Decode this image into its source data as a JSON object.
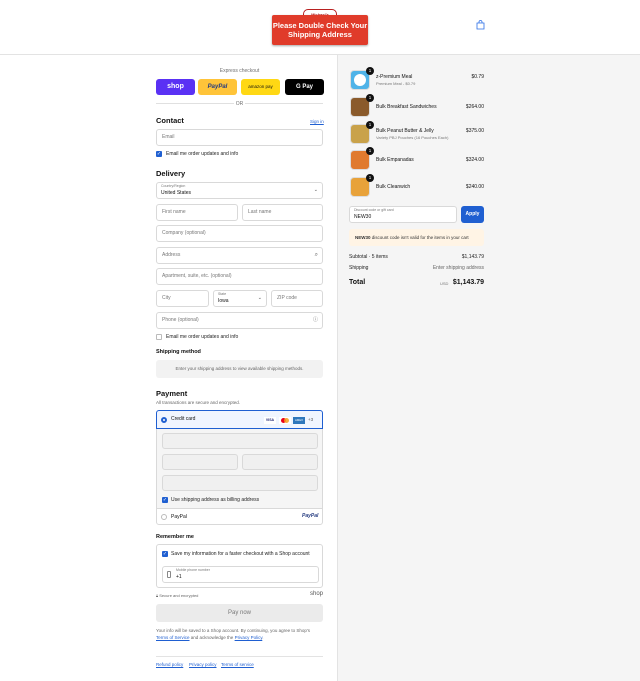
{
  "header": {
    "logo_badge": "Michael's KITCHEN",
    "logo_banner": "Please Double Check Your Shipping Address",
    "cart_icon": "bag-icon"
  },
  "express": {
    "label": "Express checkout",
    "shop": "shop",
    "paypal": "PayPal",
    "amazon": "amazon pay",
    "gpay": "G Pay",
    "or": "OR"
  },
  "contact": {
    "heading": "Contact",
    "signin": "Sign in",
    "email_placeholder": "Email",
    "email_opt": "Email me order updates and info"
  },
  "delivery": {
    "heading": "Delivery",
    "country_label": "Country/Region",
    "country_value": "United States",
    "first": "First name",
    "last": "Last name",
    "company": "Company (optional)",
    "address": "Address",
    "apartment": "Apartment, suite, etc. (optional)",
    "city": "City",
    "state_label": "State",
    "state_value": "Iowa",
    "zip": "ZIP code",
    "phone": "Phone (optional)",
    "phone_opt": "Email me order updates and info"
  },
  "shipping": {
    "heading": "Shipping method",
    "message": "Enter your shipping address to view available shipping methods."
  },
  "payment": {
    "heading": "Payment",
    "secure": "All transactions are secure and encrypted.",
    "credit": "Credit card",
    "cards": [
      "VISA",
      "MC",
      "AMEX",
      "+3"
    ],
    "billing": "Use shipping address as billing address",
    "paypal": "PayPal",
    "paypal_logo": "PayPal"
  },
  "remember": {
    "heading": "Remember me",
    "save": "Save my information for a faster checkout with a Shop account",
    "phone_label": "Mobile phone number",
    "phone_value": "+1",
    "secure": "Secure and encrypted",
    "shop": "shop",
    "pay": "Pay now",
    "legal_1": "Your info will be saved to a Shop account. By continuing, you agree to Shop's",
    "terms": "Terms of Service",
    "legal_2": "and acknowledge the",
    "privacy": "Privacy Policy",
    "period": "."
  },
  "footer": {
    "links": [
      "Refund policy",
      "Privacy policy",
      "Terms of service"
    ]
  },
  "cart": {
    "items": [
      {
        "qty": "1",
        "title": "z-Premium Meal",
        "sub": "Premium Meal - $0.79",
        "price": "$0.79"
      },
      {
        "qty": "1",
        "title": "Bulk Breakfast Sandwiches",
        "sub": "",
        "price": "$264.00"
      },
      {
        "qty": "1",
        "title": "Bulk Peanut Butter & Jelly",
        "sub": "Variety PBJ Pouches (16 Pouches Each)",
        "price": "$375.00"
      },
      {
        "qty": "1",
        "title": "Bulk Empanadas",
        "sub": "",
        "price": "$324.00"
      },
      {
        "qty": "1",
        "title": "Bulk Cleanwich",
        "sub": "",
        "price": "$240.00"
      }
    ],
    "discount_label": "Discount code or gift card",
    "discount_value": "NEW30",
    "apply": "Apply",
    "notice_code": "NEW30",
    "notice_text": "discount code isn't valid for the items in your cart",
    "subtotal_label": "Subtotal · 5 items",
    "subtotal": "$1,143.79",
    "shipping_label": "Shipping",
    "shipping_value": "Enter shipping address",
    "total_label": "Total",
    "currency": "USD",
    "total": "$1,143.79"
  }
}
